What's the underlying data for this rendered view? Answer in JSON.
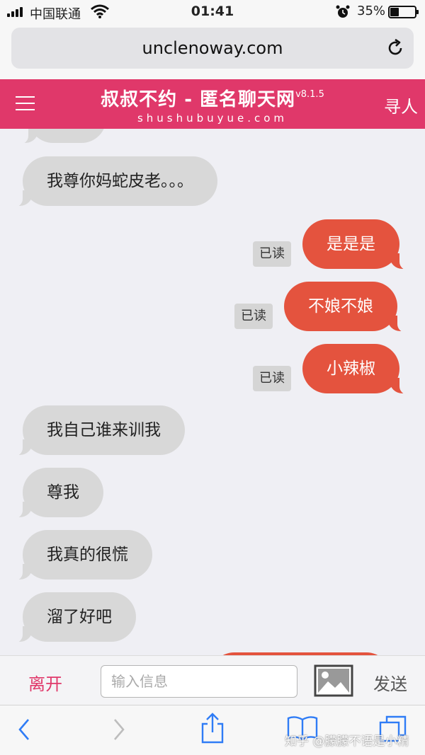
{
  "status_bar": {
    "carrier": "中国联通",
    "time": "01:41",
    "battery_percent_text": "35%",
    "battery_level": 0.35
  },
  "browser": {
    "url": "unclenoway.com"
  },
  "header": {
    "title": "叔叔不约 - 匿名聊天网",
    "version": "v8.1.5",
    "subtitle": "shushubuyue.com",
    "find_button": "寻人"
  },
  "messages": [
    {
      "direction": "in",
      "text": "我尊你妈蛇皮老。。。"
    },
    {
      "direction": "out",
      "text": "是是是",
      "read_status": "已读"
    },
    {
      "direction": "out",
      "text": "不娘不娘",
      "read_status": "已读"
    },
    {
      "direction": "out",
      "text": "小辣椒",
      "read_status": "已读"
    },
    {
      "direction": "in",
      "text": "我自己谁来训我"
    },
    {
      "direction": "in",
      "text": "尊我"
    },
    {
      "direction": "in",
      "text": "我真的很慌"
    },
    {
      "direction": "in",
      "text": "溜了好吧"
    }
  ],
  "input_bar": {
    "leave_button": "离开",
    "placeholder": "输入信息",
    "send_button": "发送"
  },
  "watermark": "知乎 @朦朦不语是小精",
  "colors": {
    "header": "#e0386a",
    "outgoing_bubble": "#e4533e",
    "incoming_bubble": "#d8d8d8"
  }
}
